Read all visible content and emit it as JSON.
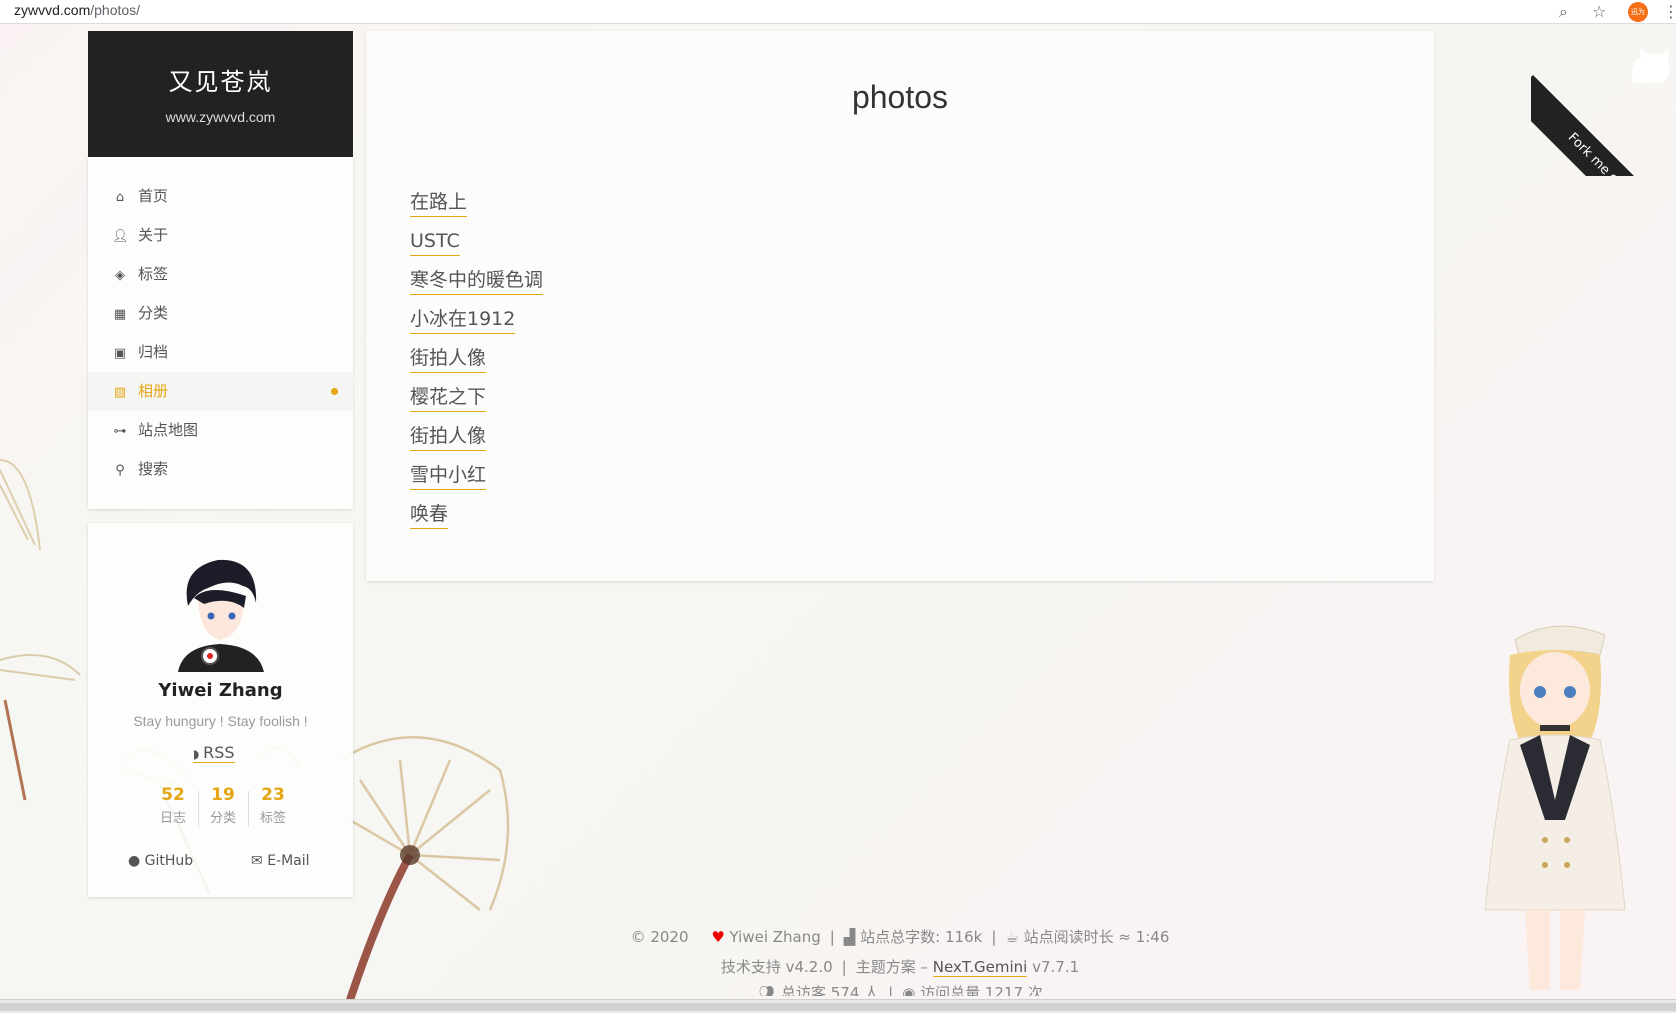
{
  "browser": {
    "url_host": "zywvvd.com",
    "url_path": "/photos/",
    "extension_label": "迅为"
  },
  "site": {
    "title": "又见苍岚",
    "subtitle": "www.zywvvd.com"
  },
  "menu": {
    "items": [
      {
        "label": "首页",
        "icon": "home-icon"
      },
      {
        "label": "关于",
        "icon": "user-icon"
      },
      {
        "label": "标签",
        "icon": "tags-icon"
      },
      {
        "label": "分类",
        "icon": "th-icon"
      },
      {
        "label": "归档",
        "icon": "archive-icon"
      },
      {
        "label": "相册",
        "icon": "image-icon",
        "active": true
      },
      {
        "label": "站点地图",
        "icon": "sitemap-icon"
      },
      {
        "label": "搜索",
        "icon": "search-icon"
      }
    ]
  },
  "author": {
    "name": "Yiwei Zhang",
    "motto": "Stay hungury ! Stay foolish !",
    "rss": "RSS",
    "stats": [
      {
        "count": "52",
        "label": "日志"
      },
      {
        "count": "19",
        "label": "分类"
      },
      {
        "count": "23",
        "label": "标签"
      }
    ],
    "github": "GitHub",
    "email": "E-Mail"
  },
  "main": {
    "title": "photos",
    "links": [
      "在路上",
      "USTC",
      "寒冬中的暖色调",
      "小冰在1912",
      "街拍人像",
      "樱花之下",
      "街拍人像",
      "雪中小红",
      "唤春"
    ]
  },
  "ribbon": {
    "text": "Fork me on GitHub"
  },
  "footer": {
    "copyright": "© 2020",
    "author": "Yiwei Zhang",
    "word_count": "站点总字数: 116k",
    "read_time": "站点阅读时长 ≈ 1:46",
    "powered": "技术支持 v4.2.0",
    "theme_prefix": "主题方案 –",
    "theme_link": "NexT.Gemini",
    "theme_version": "v7.7.1",
    "visitors": "总访客 574 人",
    "views": "访问总量 1217 次"
  },
  "colors": {
    "accent": "#e5a615",
    "brand_bg": "#222222"
  }
}
